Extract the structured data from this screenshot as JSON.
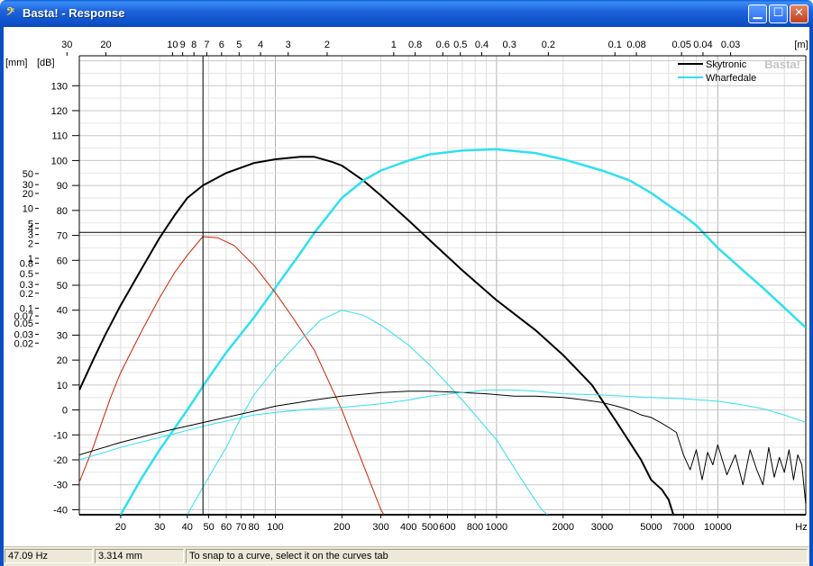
{
  "window": {
    "title": "Basta! - Response",
    "icon": "bass-clef-icon",
    "buttons": [
      "minimize",
      "maximize",
      "close"
    ]
  },
  "status": {
    "frequency": "47.09 Hz",
    "value": "3.314 mm",
    "hint": "To snap to a curve, select it on the curves tab"
  },
  "chart_data": {
    "type": "line",
    "xscale": "log",
    "xlim": [
      13,
      25000
    ],
    "x_unit_label": "Hz",
    "x_ticks": [
      20,
      30,
      40,
      50,
      60,
      70,
      80,
      100,
      200,
      300,
      400,
      500,
      600,
      800,
      1000,
      2000,
      3000,
      5000,
      7000,
      10000
    ],
    "top_axis_unit": "[m]",
    "top_ticks": [
      "30",
      "20",
      "10",
      "9",
      "8",
      "7",
      "6",
      "5",
      "4",
      "3",
      "2",
      "1",
      "0.8",
      "0.6",
      "0.5",
      "0.4",
      "0.3",
      "0.2",
      "0.1",
      "0.08",
      "0.05",
      "0.04",
      "0.03"
    ],
    "left_axis_unit": "[mm]",
    "left_ticks": [
      "50",
      "30",
      "20",
      "10",
      "5",
      "4",
      "3",
      "2",
      "1",
      "0.8",
      "0.5",
      "0.3",
      "0.2",
      "0.1",
      "0.07",
      "0.05",
      "0.03",
      "0.02"
    ],
    "ylabel": "[dB]",
    "ylim": [
      -42,
      142
    ],
    "y_ticks": [
      130,
      120,
      110,
      100,
      90,
      80,
      70,
      60,
      50,
      40,
      30,
      20,
      10,
      0,
      -10,
      -20,
      -30,
      -40
    ],
    "grid": true,
    "legend_position": "top-right",
    "watermark": "Basta!",
    "cursor": {
      "x": 47.09,
      "y": 71.2
    },
    "series": [
      {
        "name": "Skytronic",
        "color": "#000000",
        "width": 2,
        "points": [
          [
            13,
            8
          ],
          [
            15,
            20
          ],
          [
            17,
            30
          ],
          [
            20,
            42
          ],
          [
            25,
            57
          ],
          [
            30,
            69
          ],
          [
            35,
            78
          ],
          [
            40,
            85
          ],
          [
            47,
            90
          ],
          [
            60,
            95
          ],
          [
            80,
            99
          ],
          [
            100,
            100.5
          ],
          [
            130,
            101.5
          ],
          [
            150,
            101.5
          ],
          [
            180,
            99.5
          ],
          [
            200,
            98
          ],
          [
            250,
            92
          ],
          [
            300,
            86
          ],
          [
            400,
            76
          ],
          [
            500,
            68
          ],
          [
            700,
            56
          ],
          [
            1000,
            44
          ],
          [
            1500,
            32
          ],
          [
            2000,
            22
          ],
          [
            2700,
            10
          ],
          [
            3500,
            -5
          ],
          [
            4500,
            -20
          ],
          [
            5000,
            -28
          ],
          [
            5600,
            -32
          ],
          [
            6000,
            -36
          ],
          [
            6300,
            -42
          ]
        ]
      },
      {
        "name": "Wharfedale",
        "color": "#2ee0f0",
        "width": 2.5,
        "points": [
          [
            20,
            -42
          ],
          [
            25,
            -27
          ],
          [
            30,
            -16
          ],
          [
            40,
            0
          ],
          [
            50,
            13
          ],
          [
            60,
            23
          ],
          [
            80,
            37
          ],
          [
            100,
            49
          ],
          [
            130,
            63
          ],
          [
            150,
            71
          ],
          [
            200,
            85
          ],
          [
            250,
            92
          ],
          [
            300,
            96
          ],
          [
            400,
            100
          ],
          [
            500,
            102.5
          ],
          [
            700,
            104
          ],
          [
            1000,
            104.5
          ],
          [
            1500,
            103
          ],
          [
            2000,
            100.5
          ],
          [
            3000,
            96
          ],
          [
            4000,
            92
          ],
          [
            5000,
            87
          ],
          [
            6000,
            82
          ],
          [
            7000,
            78
          ],
          [
            8000,
            74
          ],
          [
            10000,
            65
          ],
          [
            13000,
            56
          ],
          [
            16000,
            49
          ],
          [
            20000,
            41
          ],
          [
            25000,
            33
          ]
        ]
      },
      {
        "color": "#cc2200",
        "width": 1,
        "points": [
          [
            13,
            -29
          ],
          [
            15,
            -15
          ],
          [
            18,
            5
          ],
          [
            20,
            15
          ],
          [
            25,
            32
          ],
          [
            30,
            45
          ],
          [
            35,
            55
          ],
          [
            40,
            62
          ],
          [
            47,
            69.5
          ],
          [
            55,
            69
          ],
          [
            65,
            66
          ],
          [
            80,
            58
          ],
          [
            100,
            47
          ],
          [
            120,
            37
          ],
          [
            150,
            24
          ],
          [
            200,
            0
          ],
          [
            250,
            -22
          ],
          [
            300,
            -40
          ],
          [
            310,
            -42
          ]
        ]
      },
      {
        "color": "#2ee0f0",
        "width": 1,
        "points": [
          [
            40,
            -42
          ],
          [
            45,
            -34
          ],
          [
            50,
            -27
          ],
          [
            60,
            -15
          ],
          [
            70,
            -3
          ],
          [
            80,
            6
          ],
          [
            100,
            17
          ],
          [
            130,
            28
          ],
          [
            160,
            36
          ],
          [
            200,
            40
          ],
          [
            250,
            38
          ],
          [
            300,
            34
          ],
          [
            400,
            26
          ],
          [
            500,
            18
          ],
          [
            700,
            4
          ],
          [
            1000,
            -12
          ],
          [
            1300,
            -28
          ],
          [
            1600,
            -40
          ],
          [
            1700,
            -42
          ]
        ]
      },
      {
        "color": "#000000",
        "width": 1,
        "points": [
          [
            13,
            -18
          ],
          [
            20,
            -13
          ],
          [
            30,
            -9
          ],
          [
            50,
            -4.5
          ],
          [
            80,
            -0.5
          ],
          [
            100,
            1.5
          ],
          [
            150,
            4
          ],
          [
            200,
            5.5
          ],
          [
            300,
            7
          ],
          [
            400,
            7.5
          ],
          [
            500,
            7.5
          ],
          [
            700,
            7
          ],
          [
            900,
            6.5
          ],
          [
            1200,
            5.5
          ],
          [
            1500,
            5.5
          ],
          [
            2000,
            5
          ],
          [
            2500,
            4
          ],
          [
            3000,
            3
          ],
          [
            3500,
            1.5
          ],
          [
            4000,
            0
          ],
          [
            4500,
            -2
          ],
          [
            5000,
            -3
          ],
          [
            5500,
            -5
          ],
          [
            6000,
            -7
          ],
          [
            6500,
            -9
          ],
          [
            7000,
            -18
          ],
          [
            7500,
            -24
          ],
          [
            8000,
            -16
          ],
          [
            8500,
            -28
          ],
          [
            9000,
            -17
          ],
          [
            9500,
            -22
          ],
          [
            10000,
            -14
          ],
          [
            11000,
            -26
          ],
          [
            12000,
            -18
          ],
          [
            13000,
            -30
          ],
          [
            14000,
            -16
          ],
          [
            15000,
            -24
          ],
          [
            16000,
            -30
          ],
          [
            17000,
            -15
          ],
          [
            18000,
            -27
          ],
          [
            19000,
            -19
          ],
          [
            20000,
            -25
          ],
          [
            21000,
            -16
          ],
          [
            22000,
            -28
          ],
          [
            23000,
            -18
          ],
          [
            24000,
            -22
          ],
          [
            25000,
            -38
          ]
        ]
      },
      {
        "color": "#2ee0f0",
        "width": 1,
        "points": [
          [
            13,
            -20
          ],
          [
            20,
            -15
          ],
          [
            30,
            -11
          ],
          [
            50,
            -6
          ],
          [
            80,
            -2
          ],
          [
            100,
            -1
          ],
          [
            150,
            0.5
          ],
          [
            200,
            1
          ],
          [
            300,
            2.5
          ],
          [
            400,
            4
          ],
          [
            500,
            5.5
          ],
          [
            700,
            7
          ],
          [
            900,
            8
          ],
          [
            1200,
            8
          ],
          [
            1500,
            7.5
          ],
          [
            2000,
            6.5
          ],
          [
            3000,
            6
          ],
          [
            5000,
            5
          ],
          [
            7000,
            4.5
          ],
          [
            10000,
            3.5
          ],
          [
            13000,
            2
          ],
          [
            16000,
            0.5
          ],
          [
            20000,
            -2
          ],
          [
            25000,
            -5
          ]
        ]
      }
    ]
  }
}
